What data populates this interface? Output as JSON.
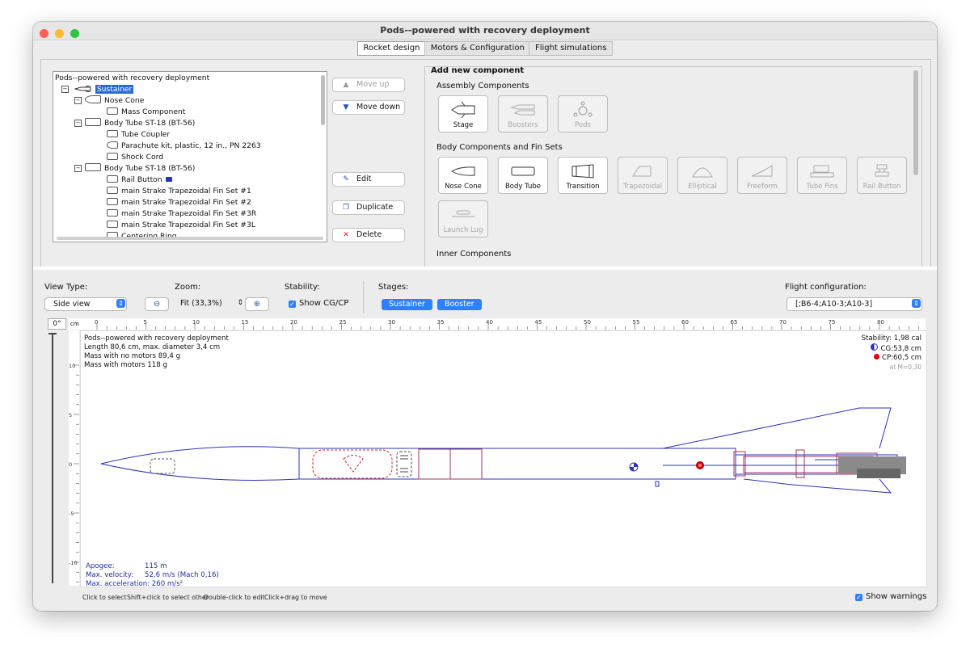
{
  "window": {
    "title": "Pods--powered with recovery deployment"
  },
  "tabs": [
    "Rocket design",
    "Motors & Configuration",
    "Flight simulations"
  ],
  "tree": {
    "root": "Pods--powered with recovery deployment",
    "items": [
      "Sustainer",
      "Nose Cone",
      "Mass Component",
      "Body Tube ST-18 (BT-56)",
      "Tube Coupler",
      "Parachute kit, plastic, 12 in., PN 2263",
      "Shock Cord",
      "Body Tube ST-18 (BT-56)",
      "Rail Button",
      "main Strake Trapezoidal Fin Set #1",
      "main Strake Trapezoidal Fin Set #2",
      "main Strake Trapezoidal Fin Set #3R",
      "main Strake Trapezoidal Fin Set #3L",
      "Centering Ring"
    ]
  },
  "buttons": {
    "move_up": "Move up",
    "move_down": "Move down",
    "edit": "Edit",
    "duplicate": "Duplicate",
    "delete": "Delete"
  },
  "add_component": {
    "title": "Add new component",
    "assembly_title": "Assembly Components",
    "assembly": [
      "Stage",
      "Boosters",
      "Pods"
    ],
    "body_title": "Body Components and Fin Sets",
    "body": [
      "Nose Cone",
      "Body Tube",
      "Transition",
      "Trapezoidal",
      "Elliptical",
      "Freeform",
      "Tube Fins",
      "Rail Button"
    ],
    "launch_lug": "Launch Lug",
    "inner_title": "Inner Components"
  },
  "view": {
    "view_type_label": "View Type:",
    "view_type": "Side view",
    "zoom_label": "Zoom:",
    "zoom": "Fit (33,3%)",
    "stability_label": "Stability:",
    "show_cgcp": "Show CG/CP",
    "stages_label": "Stages:",
    "stages": [
      "Sustainer",
      "Booster"
    ],
    "flight_config_label": "Flight configuration:",
    "flight_config": "[;B6-4;A10-3;A10-3]",
    "angle": "0°"
  },
  "ruler": {
    "unit": "cm",
    "top": [
      "0",
      "5",
      "10",
      "15",
      "20",
      "25",
      "30",
      "35",
      "40",
      "45",
      "50",
      "55",
      "60",
      "65",
      "70",
      "75",
      "80"
    ],
    "left": [
      "10",
      "5",
      "0",
      "-5",
      "-10"
    ]
  },
  "info": {
    "name": "Pods--powered with recovery deployment",
    "length": "Length 80,6 cm, max. diameter 3,4 cm",
    "mass_no_motors": "Mass with no motors 89,4 g",
    "mass_with_motors": "Mass with motors 118 g",
    "stability": "Stability: 1,98 cal",
    "cg": "CG:53,8 cm",
    "cp": "CP:60,5 cm",
    "mach": "at M=0,30",
    "apogee_label": "Apogee:",
    "apogee": "115 m",
    "velocity_label": "Max. velocity:",
    "velocity": "52,6 m/s  (Mach 0,16)",
    "accel": "Max. acceleration: 260 m/s²"
  },
  "hints": [
    "Click to select",
    "Shift+click to select other",
    "Double-click to edit",
    "Click+drag to move"
  ],
  "show_warnings": "Show warnings",
  "colors": {
    "accent": "#2f80ff",
    "body": "#2a33b8",
    "inner": "#a0306a",
    "parachute": "#e02020",
    "cp": "#e00000"
  }
}
